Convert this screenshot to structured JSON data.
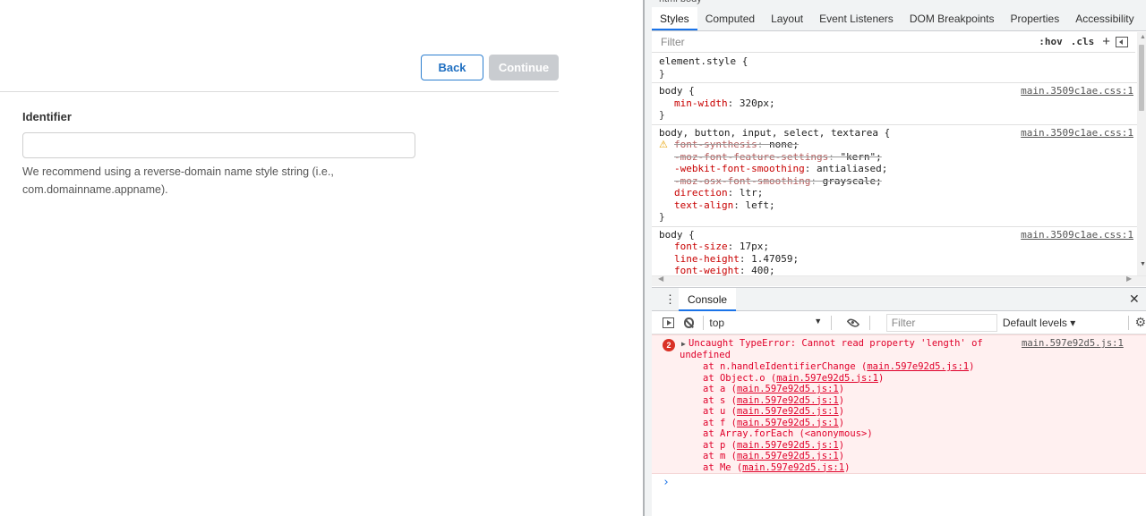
{
  "app": {
    "back_label": "Back",
    "continue_label": "Continue",
    "identifier_label": "Identifier",
    "identifier_value": "",
    "help_text": "We recommend using a reverse-domain name style string (i.e., com.domainname.appname)."
  },
  "devtools": {
    "breadcrumb": "html   body",
    "tabs": [
      "Styles",
      "Computed",
      "Layout",
      "Event Listeners",
      "DOM Breakpoints",
      "Properties",
      "Accessibility"
    ],
    "filter_placeholder": "Filter",
    "hov_label": ":hov",
    "cls_label": ".cls",
    "rules": [
      {
        "selector": "element.style {",
        "source": "",
        "decls": []
      },
      {
        "selector": "body {",
        "source": "main.3509c1ae.css:1",
        "decls": [
          {
            "prop": "min-width",
            "val": "320px;",
            "struck": false
          }
        ]
      },
      {
        "selector": "body, button, input, select, textarea {",
        "source": "main.3509c1ae.css:1",
        "decls": [
          {
            "prop": "font-synthesis",
            "val": "none;",
            "struck": true,
            "warn": true
          },
          {
            "prop": "-moz-font-feature-settings",
            "val": "\"kern\";",
            "struck": true
          },
          {
            "prop": "-webkit-font-smoothing",
            "val": "antialiased;",
            "struck": false
          },
          {
            "prop": "-moz-osx-font-smoothing",
            "val": "grayscale;",
            "struck": true
          },
          {
            "prop": "direction",
            "val": "ltr;",
            "struck": false
          },
          {
            "prop": "text-align",
            "val": "left;",
            "struck": false
          }
        ]
      },
      {
        "selector": "body {",
        "source": "main.3509c1ae.css:1",
        "decls": [
          {
            "prop": "font-size",
            "val": "17px;",
            "struck": false
          },
          {
            "prop": "line-height",
            "val": "1.47059;",
            "struck": false
          },
          {
            "prop": "font-weight",
            "val": "400;",
            "struck": false
          }
        ]
      }
    ],
    "console": {
      "tab_label": "Console",
      "context": "top",
      "filter_placeholder": "Filter",
      "levels": "Default levels ▾",
      "error_count": "2",
      "error_message": "Uncaught TypeError: Cannot read property 'length' of",
      "error_message_cont": "undefined",
      "error_source": "main.597e92d5.js:1",
      "stack": [
        {
          "pre": "at n.handleIdentifierChange (",
          "link": "main.597e92d5.js:1",
          "post": ")"
        },
        {
          "pre": "at Object.o (",
          "link": "main.597e92d5.js:1",
          "post": ")"
        },
        {
          "pre": "at a (",
          "link": "main.597e92d5.js:1",
          "post": ")"
        },
        {
          "pre": "at s (",
          "link": "main.597e92d5.js:1",
          "post": ")"
        },
        {
          "pre": "at u (",
          "link": "main.597e92d5.js:1",
          "post": ")"
        },
        {
          "pre": "at f (",
          "link": "main.597e92d5.js:1",
          "post": ")"
        },
        {
          "pre": "at Array.forEach (<anonymous>)",
          "link": "",
          "post": ""
        },
        {
          "pre": "at p (",
          "link": "main.597e92d5.js:1",
          "post": ")"
        },
        {
          "pre": "at m (",
          "link": "main.597e92d5.js:1",
          "post": ")"
        },
        {
          "pre": "at Me (",
          "link": "main.597e92d5.js:1",
          "post": ")"
        }
      ],
      "prompt": "›"
    }
  }
}
